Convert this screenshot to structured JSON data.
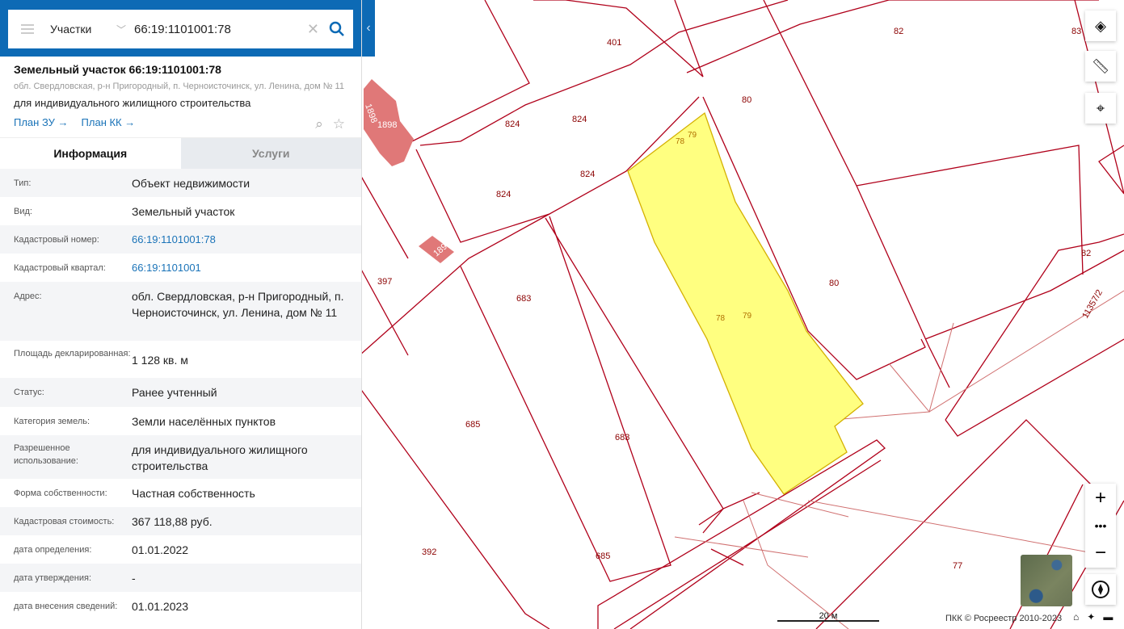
{
  "search": {
    "type": "Участки",
    "value": "66:19:1101001:78"
  },
  "object": {
    "title": "Земельный участок 66:19:1101001:78",
    "address": "обл. Свердловская, р-н Пригородный, п. Черноисточинск, ул. Ленина, дом № 11",
    "use": "для индивидуального жилищного строительства",
    "links": [
      "План ЗУ →",
      "План КК →"
    ]
  },
  "tabs": [
    "Информация",
    "Услуги"
  ],
  "rows": [
    {
      "label": "Тип:",
      "value": "Объект недвижимости"
    },
    {
      "label": "Вид:",
      "value": "Земельный участок"
    },
    {
      "label": "Кадастровый номер:",
      "value": "66:19:1101001:78"
    },
    {
      "label": "Кадастровый квартал:",
      "value": "66:19:1101001"
    },
    {
      "label": "Адрес:",
      "value": "обл. Свердловская, р-н Пригородный, п. Черноисточинск, ул. Ленина, дом № 11"
    },
    {
      "label": "Площадь декларированная:",
      "value": "1 128 кв. м"
    },
    {
      "label": "Статус:",
      "value": "Ранее учтенный"
    },
    {
      "label": "Категория земель:",
      "value": "Земли населённых пунктов"
    },
    {
      "label": "Разрешенное использование:",
      "value": "для индивидуального жилищного строительства"
    },
    {
      "label": "Форма собственности:",
      "value": "Частная собственность"
    },
    {
      "label": "Кадастровая стоимость:",
      "value": "367 118,88 руб."
    },
    {
      "label": "дата определения:",
      "value": "01.01.2022"
    },
    {
      "label": "дата утверждения:",
      "value": "-"
    },
    {
      "label": "дата внесения сведений:",
      "value": "01.01.2023"
    }
  ],
  "map": {
    "labels": [
      "401",
      "82",
      "83",
      "80",
      "824",
      "824",
      "824",
      "824",
      "78",
      "79",
      "397",
      "683",
      "80",
      "78",
      "79",
      "82",
      "11357/2",
      "685",
      "683",
      "392",
      "685",
      "77",
      "1898",
      "1898",
      "1899"
    ],
    "scale": "20 м",
    "copyright": "ПКК © Росреестр 2010-2023"
  },
  "colors": {
    "accent": "#0d6ab5",
    "parcel_fill": "#ffff80",
    "border": "#b0001a"
  }
}
